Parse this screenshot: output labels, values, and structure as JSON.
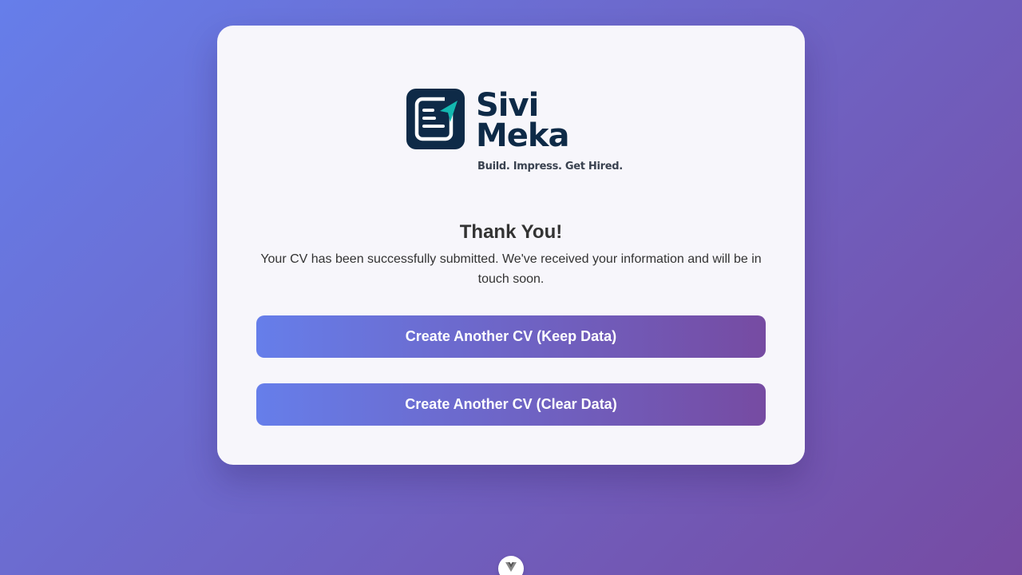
{
  "logo": {
    "name_line1": "Sivi",
    "name_line2": "Meka",
    "tagline": "Build. Impress. Get Hired.",
    "icon": "document-send-icon"
  },
  "confirmation": {
    "heading": "Thank You!",
    "message": "Your CV has been successfully submitted. We've received your information and will be in touch soon."
  },
  "actions": {
    "keep_data_label": "Create Another CV (Keep Data)",
    "clear_data_label": "Create Another CV (Clear Data)"
  },
  "footer": {
    "badge_icon": "vue-logo-icon"
  },
  "colors": {
    "background_start": "#667eea",
    "background_end": "#764ba2",
    "brand_navy": "#0e2a47",
    "brand_teal": "#14b8b0",
    "text": "#333333"
  }
}
